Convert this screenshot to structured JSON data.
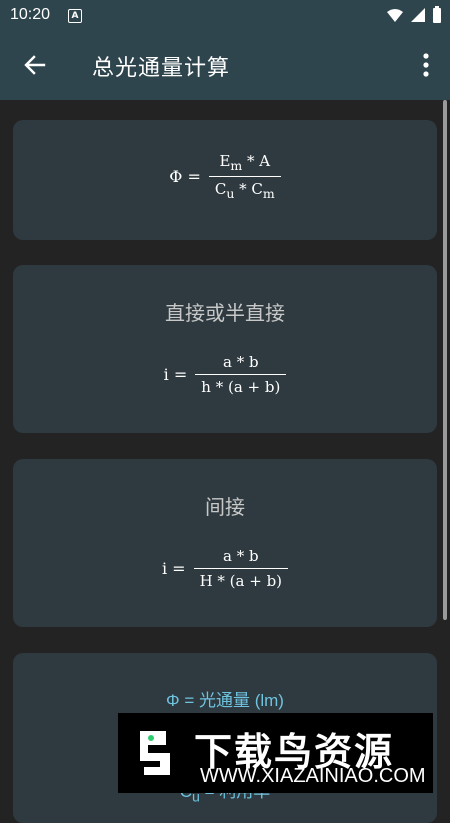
{
  "status": {
    "time": "10:20",
    "notif": "A"
  },
  "appbar": {
    "title": "总光通量计算"
  },
  "cards": [
    {
      "lhs": "Φ =",
      "num": "E<sub>m</sub> * A",
      "den": "C<sub>u</sub> * C<sub>m</sub>"
    },
    {
      "title": "直接或半直接",
      "lhs": "i =",
      "num": "a * b",
      "den": "h * (a + b)"
    },
    {
      "title": "间接",
      "lhs": "i =",
      "num": "a * b",
      "den": "H * (a + b)"
    }
  ],
  "defs": [
    "Φ = 光通量 (lm)",
    "C<sub>u</sub> = 利用率"
  ],
  "banner": {
    "title": "下载鸟资源",
    "url": "WWW.XIAZAINIAO.COM"
  }
}
